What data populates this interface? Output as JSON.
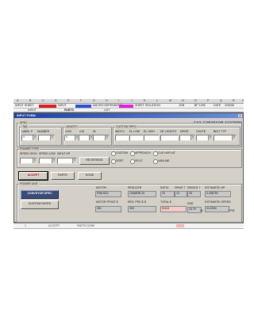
{
  "sheet": {
    "columns": [
      "A",
      "B",
      "C",
      "D",
      "E",
      "F",
      "G",
      "H",
      "I",
      "J",
      "K",
      "L",
      "M",
      "N",
      "O",
      "P",
      "Q",
      "R",
      "S"
    ],
    "row1": {
      "cells": [
        "INPUT SHEET",
        "INPUT",
        "MACRO DEPENDENT",
        "SHEET ISOLATION",
        "JOB",
        "BF 1295",
        "DATE",
        "3/30/06"
      ],
      "swatch_colors": [
        "#d42020",
        "#2a4fd0",
        "#e020e0"
      ]
    },
    "row2": {
      "tabs": [
        "INPUT",
        "PARTS",
        "LIST"
      ]
    },
    "bottom_row": [
      "1",
      "",
      "ACCEPT",
      "PARTS DONE"
    ]
  },
  "dialog": {
    "title": "INPUT FORM",
    "close": "x",
    "brand": "C&S CONVEYOR SYSTEMS",
    "spec": {
      "label": "SPEC",
      "tail": {
        "label": "TAIL",
        "label_p": "LABEL P",
        "number": "NUMBER",
        "label_p_value": "4"
      },
      "length": {
        "label": "LENGTH",
        "x100": "X100",
        "x10": "X10",
        "in": "IN",
        "x100_value": "0"
      },
      "custom_spec": {
        "label": "CUSTOM SPEC",
        "fields": [
          "WIDTH",
          "EL LOW",
          "EL HIGH",
          "DE LENGTH",
          "DRIVE",
          "CHUTE",
          "BELT TYP"
        ]
      }
    },
    "power_type": {
      "label": "POWER TYPE",
      "speed_high": "SPEED HIGH",
      "speed_low": "SPEED LOW",
      "input_hp": "INPUT HP",
      "reversing": "REVERSING",
      "options": [
        "CUSTOM",
        "APPROACH",
        "CUS HUPLAT",
        "SORT",
        "SPLIT",
        "VANLINE"
      ]
    },
    "buttons": {
      "accept": "ACCEPT",
      "parts": "PARTS",
      "done": "DONE"
    },
    "power_unit": {
      "label": "POWER UNIT",
      "conveyor_spec": "CONVEYOR SPEC",
      "custom_rated": "CUSTOM RATED",
      "motor": {
        "label": "MOTOR",
        "value": "P56HS21"
      },
      "reducer": {
        "label": "REDUCER",
        "value": "CM65RB 20"
      },
      "ratio": {
        "label": "RATIO",
        "value": "20"
      },
      "drive_t": {
        "label": "DRIVE T",
        "value": "13"
      },
      "driven_t": {
        "label": "DRIVEN T",
        "value": "25"
      },
      "estimated_hp": {
        "label": "ESTIMATED HP",
        "value": "0.498750"
      },
      "motor_price": {
        "label": "MOTOR PRICE $",
        "value": "281"
      },
      "red_price": {
        "label": "RED. PRICE $",
        "value": "303"
      },
      "total": {
        "label": "TOTAL $",
        "value": "515.8"
      },
      "dsd": {
        "label": "DSD",
        "value": "15.79",
        "suffix": "IN"
      },
      "estimated_speed": {
        "label": "ESTIMATED SPEED",
        "value": "94.0990",
        "unit": "FPM"
      }
    }
  }
}
